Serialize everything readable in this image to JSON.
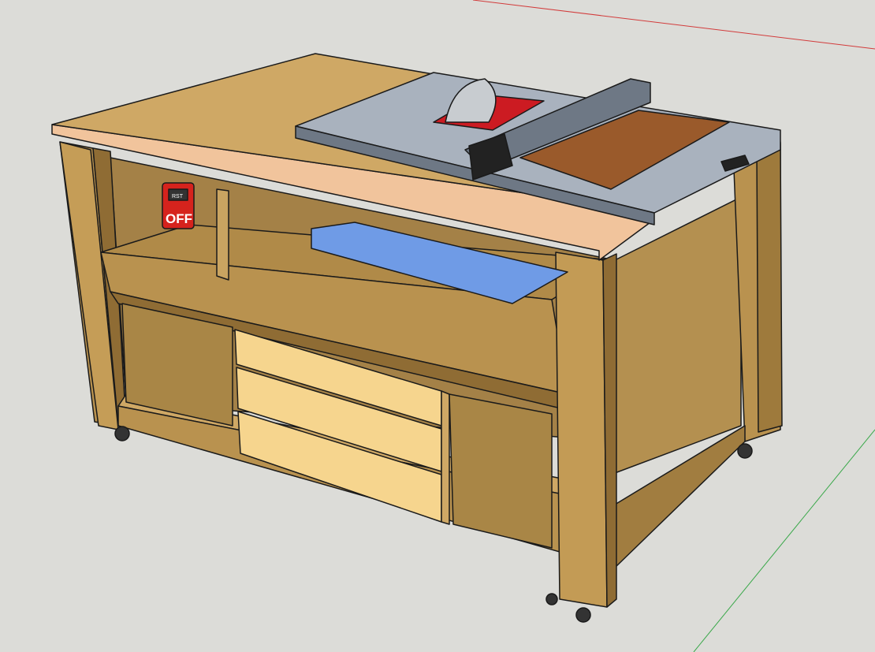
{
  "app": "SketchUp",
  "scene": {
    "model": "table-saw-workbench",
    "switch_label": "OFF",
    "switch_small_label": "RST",
    "colors": {
      "background": "#dcdcd8",
      "wood": "#b9924f",
      "wood_light": "#cfa865",
      "wood_dark": "#8f6c34",
      "top_edge": "#f1c49c",
      "drawer": "#f6d58e",
      "saw_gray": "#a9b2be",
      "saw_dark": "#6e7885",
      "blade": "#c8ccd0",
      "insert_red": "#cc1b22",
      "sled_blue": "#6f9be6",
      "walnut": "#9a5a2b",
      "switch_red": "#d6231d",
      "axis_red": "#d23b3b",
      "axis_green": "#3aa84a"
    },
    "drawers": 3,
    "casters": 4
  }
}
